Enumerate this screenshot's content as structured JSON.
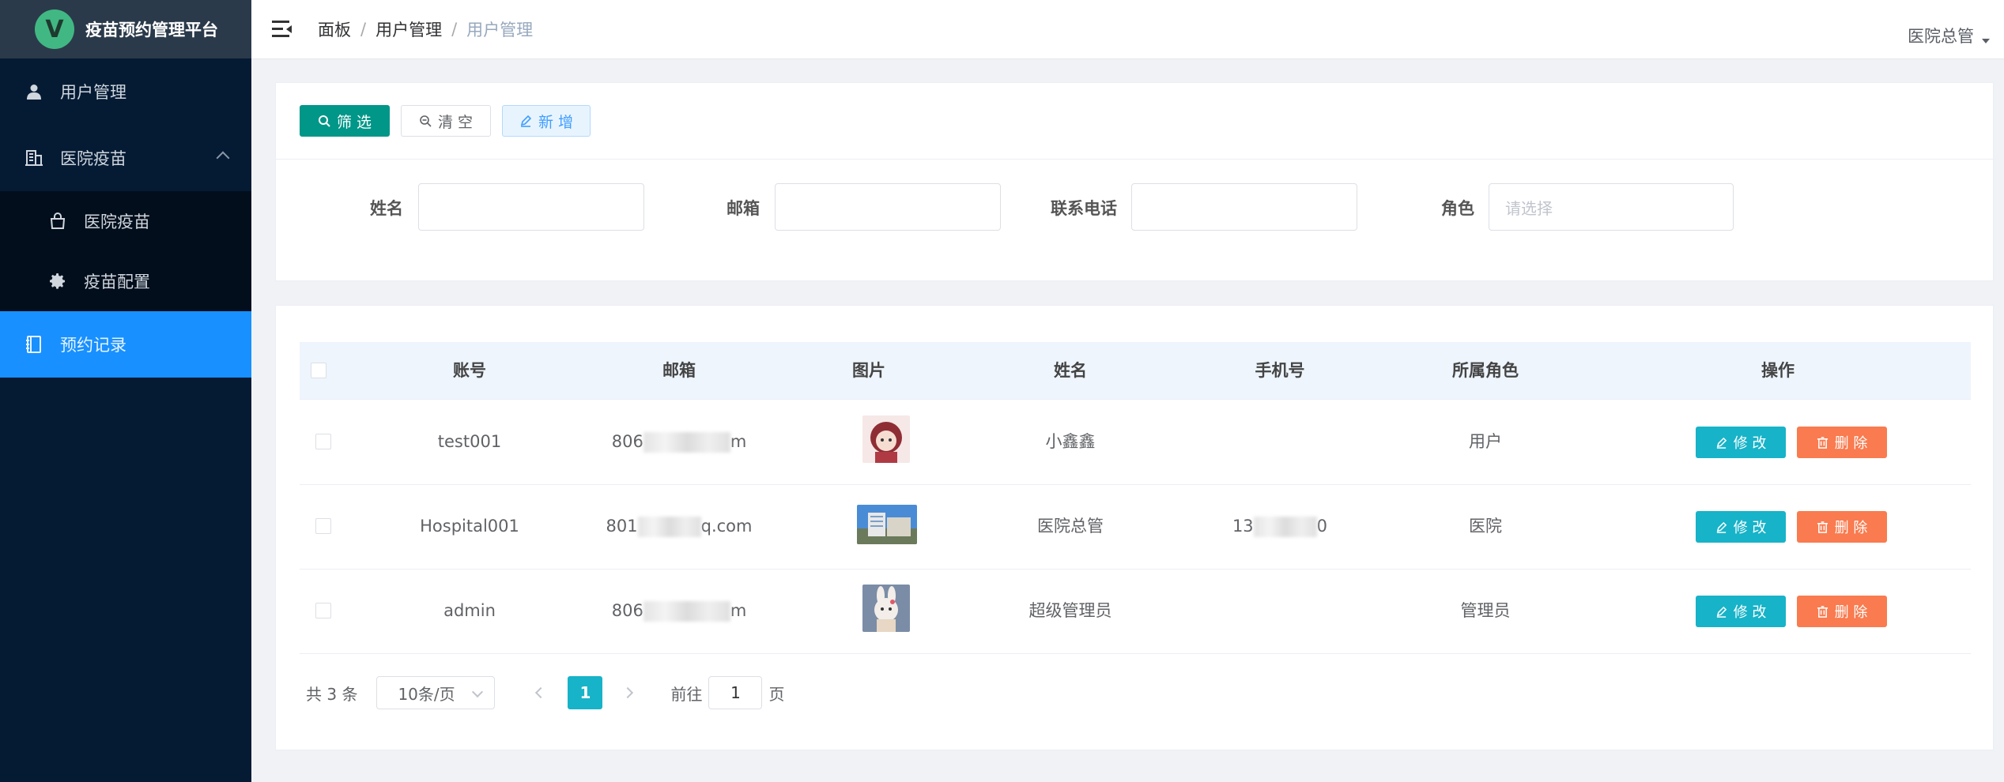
{
  "app": {
    "logo_letter": "V",
    "title": "疫苗预约管理平台"
  },
  "sidebar": {
    "items": [
      {
        "label": "用户管理",
        "icon": "user-icon"
      },
      {
        "label": "医院疫苗",
        "icon": "building-icon",
        "expanded": true,
        "children": [
          {
            "label": "医院疫苗",
            "icon": "shopping-bag-icon"
          },
          {
            "label": "疫苗配置",
            "icon": "gear-icon"
          }
        ]
      },
      {
        "label": "预约记录",
        "icon": "notebook-icon",
        "active": true
      }
    ]
  },
  "header": {
    "breadcrumb": [
      "面板",
      "用户管理",
      "用户管理"
    ],
    "user": "医院总管"
  },
  "toolbar": {
    "filter_label": "筛 选",
    "clear_label": "清 空",
    "add_label": "新 增"
  },
  "filters": {
    "name_label": "姓名",
    "name_value": "",
    "email_label": "邮箱",
    "email_value": "",
    "phone_label": "联系电话",
    "phone_value": "",
    "role_label": "角色",
    "role_placeholder": "请选择"
  },
  "table": {
    "columns": [
      "账号",
      "邮箱",
      "图片",
      "姓名",
      "手机号",
      "所属角色",
      "操作"
    ],
    "rows": [
      {
        "account": "test001",
        "email_prefix": "806",
        "email_suffix": "m",
        "name": "小鑫鑫",
        "phone_prefix": "",
        "phone_suffix": "",
        "role": "用户"
      },
      {
        "account": "Hospital001",
        "email_prefix": "801",
        "email_suffix": "q.com",
        "name": "医院总管",
        "phone_prefix": "13",
        "phone_suffix": "0",
        "role": "医院"
      },
      {
        "account": "admin",
        "email_prefix": "806",
        "email_suffix": "m",
        "name": "超级管理员",
        "phone_prefix": "",
        "phone_suffix": "",
        "role": "管理员"
      }
    ],
    "edit_label": "修 改",
    "delete_label": "删 除"
  },
  "pagination": {
    "total_text": "共 3 条",
    "page_size": "10条/页",
    "current_page": "1",
    "goto_label": "前往",
    "goto_value": "1",
    "goto_suffix": "页"
  },
  "colors": {
    "sidebar_bg": "#051b34",
    "active_menu": "#1890ff",
    "filter_button": "#009688",
    "edit_button": "#17b3c8",
    "delete_button": "#f97b4f"
  }
}
